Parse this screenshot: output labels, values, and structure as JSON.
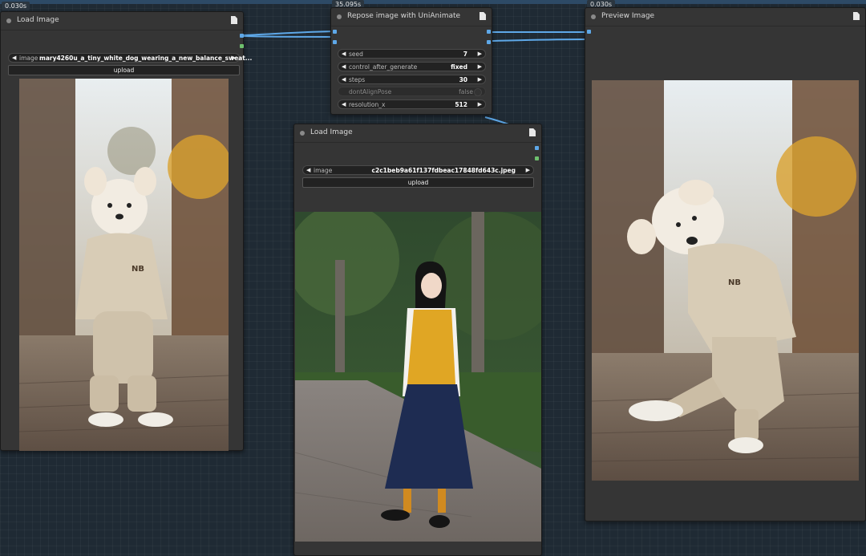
{
  "timings": {
    "left": "0.030s",
    "center": "35.095s",
    "right": "0.030s"
  },
  "nodes": {
    "load_image_1": {
      "title": "Load Image",
      "image_widget": {
        "label": "image",
        "value": "mary4260u_a_tiny_white_dog_wearing_a_new_balance_sweat..."
      },
      "upload_label": "upload",
      "preview_subject": "small white dog in beige hooded sweatsuit standing on cobbled street"
    },
    "repose": {
      "title": "Repose image with UniAnimate",
      "widgets": [
        {
          "label": "seed",
          "value": "7"
        },
        {
          "label": "control_after_generate",
          "value": "fixed"
        },
        {
          "label": "steps",
          "value": "30"
        },
        {
          "label": "dontAlignPose",
          "value": "false"
        },
        {
          "label": "resolution_x",
          "value": "512"
        }
      ]
    },
    "load_image_2": {
      "title": "Load Image",
      "image_widget": {
        "label": "image",
        "value": "c2c1beb9a61f137fdbeac17848fd643c.jpeg"
      },
      "upload_label": "upload",
      "preview_subject": "woman in yellow vest and navy skirt posing on park path"
    },
    "preview": {
      "title": "Preview Image",
      "preview_subject": "white dog in beige sweatsuit in dancing pose on cobbled street"
    }
  },
  "colors": {
    "canvas": "#1f2a34",
    "node_bg": "#353535",
    "link_blue": "#5ea8e8",
    "link_green": "#6ec06e"
  }
}
